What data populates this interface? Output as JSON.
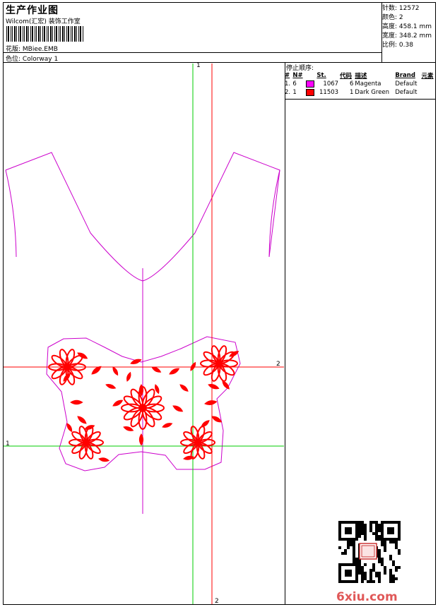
{
  "header": {
    "title": "生产作业图",
    "studio": "Wilcom(汇宏) 装饰工作室",
    "design_label": "花版:",
    "design_value": "MBiee.EMB",
    "colorway_label": "色位:",
    "colorway_value": "Colorway 1"
  },
  "stats": {
    "stitches": "针数: 12572",
    "colors": "颜色: 2",
    "height": "高度: 458.1 mm",
    "width": "宽度: 348.2 mm",
    "scale": "比例: 0.38"
  },
  "stop_sequence": {
    "title": "停止顺序:",
    "headers": [
      "#",
      "N#",
      "St.",
      "代码",
      "描述",
      "Brand",
      "元素"
    ],
    "rows": [
      {
        "seq": "1.",
        "needle": "6",
        "color": "#ff00ff",
        "stitches": "1067",
        "code": "6",
        "desc": "Magenta",
        "brand": "Default",
        "element": ""
      },
      {
        "seq": "2.",
        "needle": "1",
        "color": "#ff0000",
        "stitches": "11503",
        "code": "1",
        "desc": "Dark Green",
        "brand": "Default",
        "element": ""
      }
    ]
  },
  "guides": {
    "v1_label": "1",
    "v2_label": "2",
    "h2_label": "2",
    "h1_label": "1"
  },
  "colors": {
    "outline": "#cc00cc",
    "embroidery": "#ff0000",
    "guide_green": "#00cc00",
    "guide_red": "#ff0000"
  },
  "watermark": "6xiu.com"
}
